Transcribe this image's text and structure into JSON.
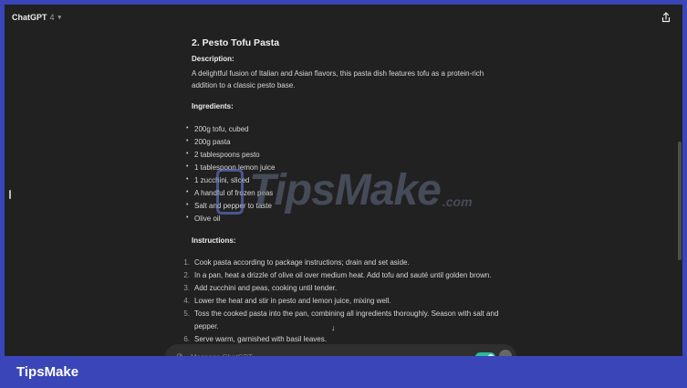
{
  "header": {
    "app_name": "ChatGPT",
    "model_version": "4",
    "chevron_icon": "chevron-down-icon",
    "share_icon": "share-icon"
  },
  "recipe": {
    "heading": "2. Pesto Tofu Pasta",
    "description_label": "Description:",
    "description_text": "A delightful fusion of Italian and Asian flavors, this pasta dish features tofu as a protein-rich addition to a classic pesto base.",
    "ingredients_label": "Ingredients:",
    "ingredients": [
      "200g tofu, cubed",
      "200g pasta",
      "2 tablespoons pesto",
      "1 tablespoon lemon juice",
      "1 zucchini, sliced",
      "A handful of frozen peas",
      "Salt and pepper to taste",
      "Olive oil"
    ],
    "instructions_label": "Instructions:",
    "instructions": [
      {
        "num": "1.",
        "text": "Cook pasta according to package instructions; drain and set aside."
      },
      {
        "num": "2.",
        "text": "In a pan, heat a drizzle of olive oil over medium heat. Add tofu and sauté until golden brown."
      },
      {
        "num": "3.",
        "text": "Add zucchini and peas, cooking until tender."
      },
      {
        "num": "4.",
        "text": "Lower the heat and stir in pesto and lemon juice, mixing well."
      },
      {
        "num": "5.",
        "text": "Toss the cooked pasta into the pan, combining all ingredients thoroughly. Season with salt and pepper."
      },
      {
        "num": "6.",
        "text": "Serve warm, garnished with basil leaves."
      }
    ]
  },
  "composer": {
    "placeholder": "Message ChatGPT"
  },
  "watermark": {
    "text": "TipsMake",
    "suffix": ".com"
  },
  "footer": {
    "brand": "TipsMake"
  },
  "colors": {
    "frame_background": "#212121",
    "page_background": "#3a46b8",
    "toggle_accent": "#2db99c"
  }
}
